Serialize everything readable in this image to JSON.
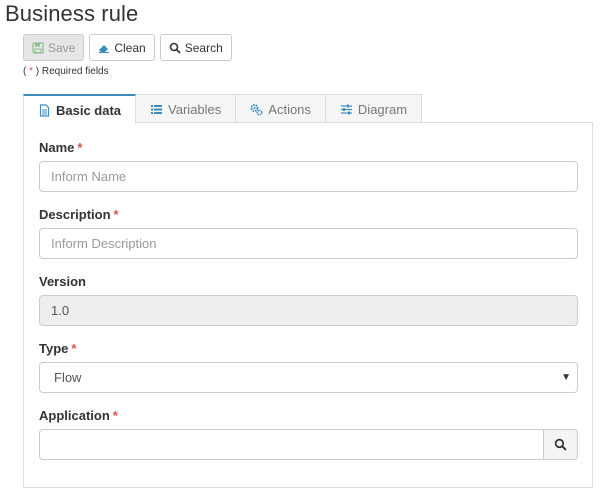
{
  "page": {
    "title": "Business rule"
  },
  "toolbar": {
    "save_label": "Save",
    "clean_label": "Clean",
    "search_label": "Search"
  },
  "required_note": {
    "prefix": "( ",
    "star": "*",
    "suffix": " ) Required fields"
  },
  "tabs": [
    {
      "label": "Basic data",
      "icon": "file-text-icon",
      "active": true
    },
    {
      "label": "Variables",
      "icon": "list-icon",
      "active": false
    },
    {
      "label": "Actions",
      "icon": "gears-icon",
      "active": false
    },
    {
      "label": "Diagram",
      "icon": "sliders-icon",
      "active": false
    }
  ],
  "form": {
    "name": {
      "label": "Name",
      "required": "*",
      "placeholder": "Inform Name",
      "value": ""
    },
    "description": {
      "label": "Description",
      "required": "*",
      "placeholder": "Inform Description",
      "value": ""
    },
    "version": {
      "label": "Version",
      "value": "1.0"
    },
    "type": {
      "label": "Type",
      "required": "*",
      "selected": "Flow"
    },
    "application": {
      "label": "Application",
      "required": "*",
      "value": ""
    }
  },
  "colors": {
    "required": "#d9534f",
    "accent": "#3c8dbc",
    "border": "#cccccc"
  }
}
